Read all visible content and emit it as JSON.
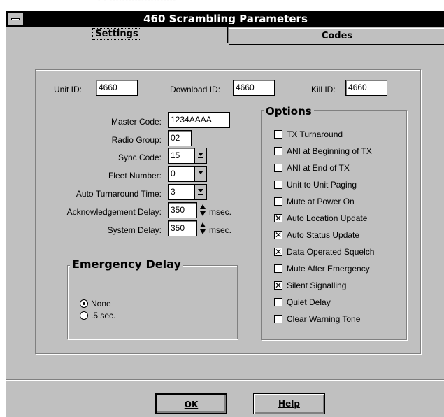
{
  "window": {
    "title": "460 Scrambling Parameters"
  },
  "tabs": [
    {
      "label": "Settings",
      "selected": true
    },
    {
      "label": "Codes",
      "selected": false
    }
  ],
  "ids": {
    "unit_label": "Unit ID:",
    "unit_value": "4660",
    "download_label": "Download ID:",
    "download_value": "4660",
    "kill_label": "Kill ID:",
    "kill_value": "4660"
  },
  "fields": {
    "master_code": {
      "label": "Master Code:",
      "value": "1234AAAA"
    },
    "radio_group": {
      "label": "Radio Group:",
      "value": "02"
    },
    "sync_code": {
      "label": "Sync Code:",
      "value": "15"
    },
    "fleet_number": {
      "label": "Fleet Number:",
      "value": "0"
    },
    "auto_turnaround": {
      "label": "Auto Turnaround Time:",
      "value": "3"
    },
    "ack_delay": {
      "label": "Acknowledgement Delay:",
      "value": "350",
      "unit": "msec."
    },
    "system_delay": {
      "label": "System Delay:",
      "value": "350",
      "unit": "msec."
    }
  },
  "emergency": {
    "title": "Emergency Delay",
    "options": [
      {
        "label": "None",
        "selected": true
      },
      {
        "label": ".5 sec.",
        "selected": false
      }
    ]
  },
  "options": {
    "title": "Options",
    "items": [
      {
        "label": "TX Turnaround",
        "checked": false
      },
      {
        "label": "ANI at Beginning of TX",
        "checked": false
      },
      {
        "label": "ANI at End of TX",
        "checked": false
      },
      {
        "label": "Unit to Unit Paging",
        "checked": false
      },
      {
        "label": "Mute at Power On",
        "checked": false
      },
      {
        "label": "Auto Location Update",
        "checked": true
      },
      {
        "label": "Auto Status Update",
        "checked": true
      },
      {
        "label": "Data Operated Squelch",
        "checked": true
      },
      {
        "label": "Mute After Emergency",
        "checked": false
      },
      {
        "label": "Silent Signalling",
        "checked": true
      },
      {
        "label": "Quiet Delay",
        "checked": false
      },
      {
        "label": "Clear Warning Tone",
        "checked": false
      }
    ]
  },
  "buttons": {
    "ok": "OK",
    "help": "Help"
  },
  "check_mark": "✕"
}
